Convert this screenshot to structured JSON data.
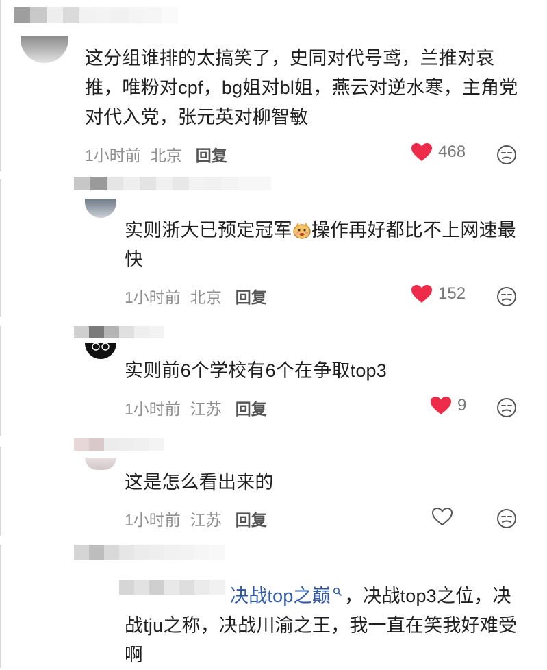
{
  "comments": [
    {
      "text": "这分组谁排的太搞笑了，史同对代号鸢，兰推对哀推，唯粉对cpf，bg姐对bl姐，燕云对逆水寒，主角党对代入党，张元英对柳智敏",
      "time": "1小时前",
      "location": "北京",
      "reply": "回复",
      "likes": "468",
      "liked": true
    },
    {
      "text_before": "实则浙大已预定冠军",
      "text_after": "操作再好都比不上网速最快",
      "emoji_name": "smirk-dog-emoji",
      "time": "1小时前",
      "location": "北京",
      "reply": "回复",
      "likes": "152",
      "liked": true
    },
    {
      "text": "实则前6个学校有6个在争取top3",
      "time": "1小时前",
      "location": "江苏",
      "reply": "回复",
      "likes": "9",
      "liked": true
    },
    {
      "text": "这是怎么看出来的",
      "time": "1小时前",
      "location": "江苏",
      "reply": "回复",
      "likes": "",
      "liked": false
    },
    {
      "link": "决战top之巅",
      "text": "，决战top3之位，决战tju之称，决战川渝之王，我一直在笑我好难受啊"
    }
  ],
  "colors": {
    "heart_active": "#ee2b48",
    "meta_gray": "#8f8f8f",
    "link_blue": "#2f5aa8"
  }
}
